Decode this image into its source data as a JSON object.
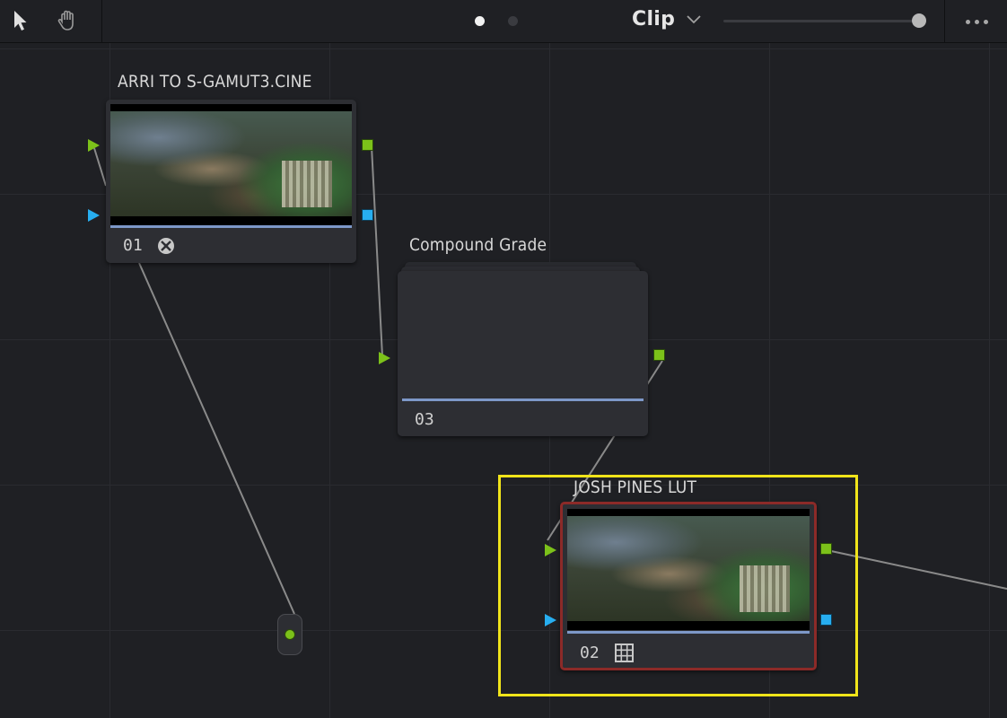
{
  "toolbar": {
    "tools": [
      {
        "name": "pointer-tool",
        "icon": "arrow-pointer-icon"
      },
      {
        "name": "hand-tool",
        "icon": "hand-icon"
      }
    ],
    "page_dots": {
      "count": 2,
      "active_index": 0
    },
    "mode_label": "Clip",
    "zoom_level": 1.0,
    "more_icon": "more-options-icon"
  },
  "nodes": [
    {
      "id": "01",
      "label": "ARRI TO S-GAMUT3.CINE",
      "number": "01",
      "badge_icon": "lut-disc-icon",
      "has_thumbnail": true
    },
    {
      "id": "03",
      "label": "Compound  Grade",
      "number": "03",
      "type": "compound"
    },
    {
      "id": "02",
      "label": "JOSH PINES LUT",
      "number": "02",
      "badge_icon": "lut-grid-icon",
      "has_thumbnail": true,
      "selected": true
    }
  ],
  "colors": {
    "background": "#1f2024",
    "node_fill": "#2d2e33",
    "rgb_port": "#7cc11a",
    "alpha_port": "#27aef0",
    "selection": "#f0e41a",
    "active_border": "#8c2a28",
    "progress": "#7d98c8"
  }
}
